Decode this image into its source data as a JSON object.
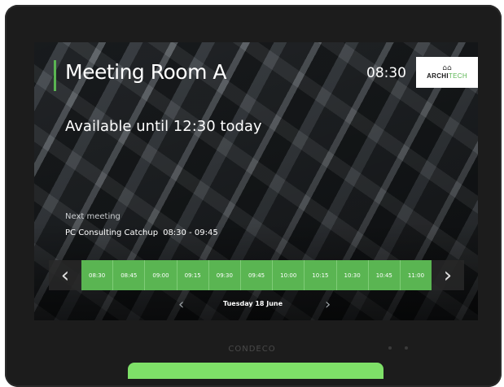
{
  "room": {
    "title": "Meeting Room A",
    "current_time": "08:30",
    "availability": "Available until 12:30 today"
  },
  "logo": {
    "mark": "⌂⌂",
    "bold_text": "ARCHI",
    "light_text": "TECH"
  },
  "next_meeting": {
    "label": "Next meeting",
    "name": "PC Consulting Catchup",
    "time": "08:30 - 09:45"
  },
  "timeline": {
    "prev_icon": "‹",
    "next_icon": "›",
    "slots": [
      "08:30",
      "08:45",
      "09:00",
      "09:15",
      "09:30",
      "09:45",
      "10:00",
      "10:15",
      "10:30",
      "10:45",
      "11:00"
    ]
  },
  "date": {
    "prev_icon": "‹",
    "label": "Tuesday 18 June",
    "next_icon": "›"
  },
  "device": {
    "brand": "CONDECO"
  },
  "colors": {
    "accent": "#5ab552",
    "glow": "#7ee068",
    "bezel": "#1c1c1c"
  }
}
